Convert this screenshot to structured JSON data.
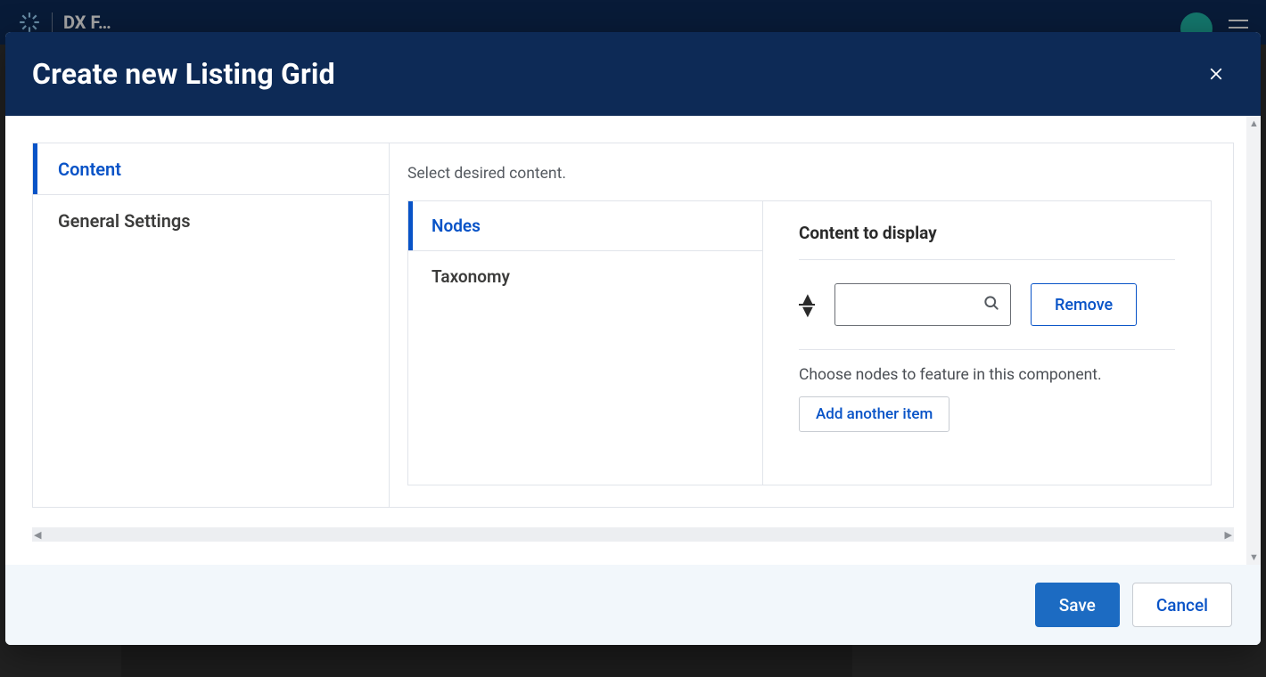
{
  "app": {
    "name_fragment": "DX F…"
  },
  "modal": {
    "title": "Create new Listing Grid"
  },
  "tabs": {
    "content": "Content",
    "general_settings": "General Settings"
  },
  "content": {
    "hint": "Select desired content.",
    "subtabs": {
      "nodes": "Nodes",
      "taxonomy": "Taxonomy"
    },
    "detail": {
      "heading": "Content to display",
      "search_value": "",
      "remove_label": "Remove",
      "help": "Choose nodes to feature in this component.",
      "add_label": "Add another item"
    }
  },
  "footer": {
    "save": "Save",
    "cancel": "Cancel"
  }
}
